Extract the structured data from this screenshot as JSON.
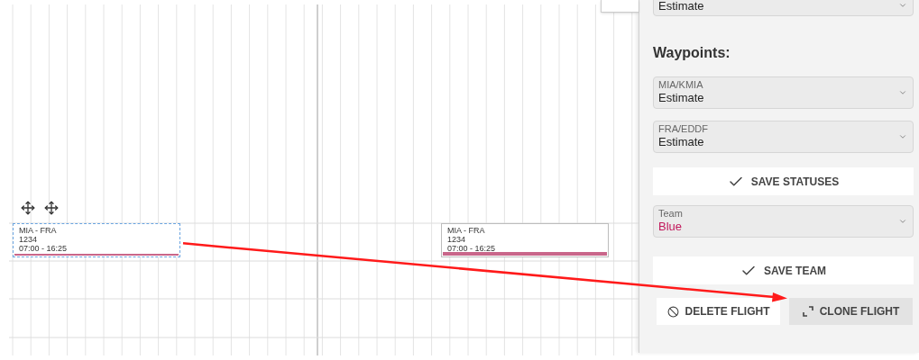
{
  "canvas": {
    "flights": [
      {
        "route": "MIA - FRA",
        "number": "1234",
        "time": "07:00 - 16:25",
        "selected": true,
        "color": "#c9668a"
      },
      {
        "route": "MIA - FRA",
        "number": "1234",
        "time": "07:00 - 16:25",
        "selected": false,
        "color": "#c9668a"
      }
    ]
  },
  "panel": {
    "status_field": {
      "value": "Estimate"
    },
    "waypoints_heading": "Waypoints:",
    "waypoints": [
      {
        "label": "MIA/KMIA",
        "value": "Estimate"
      },
      {
        "label": "FRA/EDDF",
        "value": "Estimate"
      }
    ],
    "save_statuses": "SAVE STATUSES",
    "team_field": {
      "label": "Team",
      "value": "Blue"
    },
    "save_team": "SAVE TEAM",
    "delete_flight": "DELETE FLIGHT",
    "clone_flight": "CLONE FLIGHT"
  }
}
